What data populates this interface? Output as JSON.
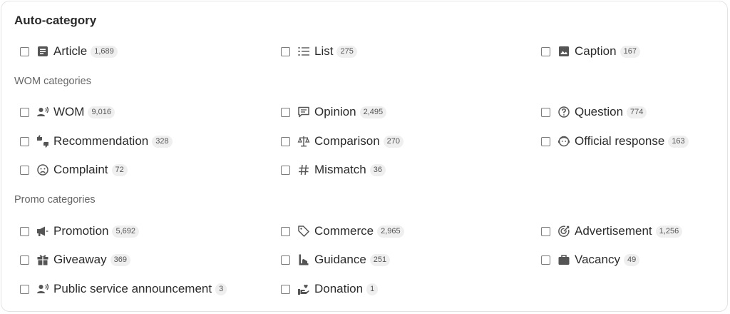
{
  "panel": {
    "title": "Auto-category",
    "auto_items": [
      {
        "label": "Article",
        "count": "1,689",
        "icon": "article-icon"
      },
      {
        "label": "List",
        "count": "275",
        "icon": "list-icon"
      },
      {
        "label": "Caption",
        "count": "167",
        "icon": "image-icon"
      }
    ],
    "wom_label": "WOM categories",
    "wom_items": [
      {
        "label": "WOM",
        "count": "9,016",
        "icon": "person-voice-icon"
      },
      {
        "label": "Opinion",
        "count": "2,495",
        "icon": "speech-bubble-icon"
      },
      {
        "label": "Question",
        "count": "774",
        "icon": "question-circle-icon"
      },
      {
        "label": "Recommendation",
        "count": "328",
        "icon": "thumbs-up-down-icon"
      },
      {
        "label": "Comparison",
        "count": "270",
        "icon": "scales-icon"
      },
      {
        "label": "Official response",
        "count": "163",
        "icon": "support-agent-icon"
      },
      {
        "label": "Complaint",
        "count": "72",
        "icon": "sad-face-icon"
      },
      {
        "label": "Mismatch",
        "count": "36",
        "icon": "hash-icon"
      }
    ],
    "promo_label": "Promo categories",
    "promo_items": [
      {
        "label": "Promotion",
        "count": "5,692",
        "icon": "megaphone-icon"
      },
      {
        "label": "Commerce",
        "count": "2,965",
        "icon": "tag-icon"
      },
      {
        "label": "Advertisement",
        "count": "1,256",
        "icon": "target-icon"
      },
      {
        "label": "Giveaway",
        "count": "369",
        "icon": "gift-icon"
      },
      {
        "label": "Guidance",
        "count": "251",
        "icon": "guidance-icon"
      },
      {
        "label": "Vacancy",
        "count": "49",
        "icon": "briefcase-icon"
      },
      {
        "label": "Public service announcement",
        "count": "3",
        "icon": "person-voice-icon"
      },
      {
        "label": "Donation",
        "count": "1",
        "icon": "donation-hand-icon"
      }
    ]
  }
}
